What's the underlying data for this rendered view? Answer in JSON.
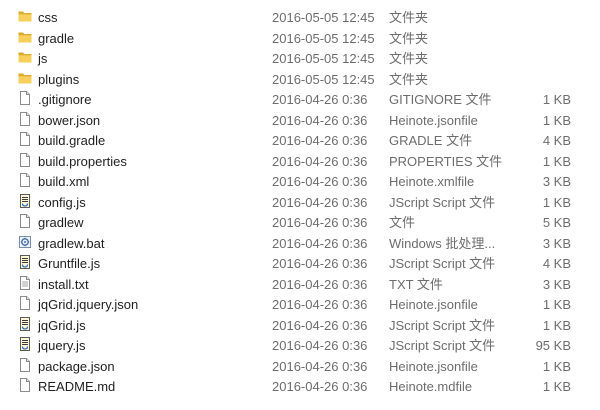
{
  "files": [
    {
      "name": "css",
      "date": "2016-05-05 12:45",
      "type": "文件夹",
      "size": "",
      "icon": "folder-icon"
    },
    {
      "name": "gradle",
      "date": "2016-05-05 12:45",
      "type": "文件夹",
      "size": "",
      "icon": "folder-icon"
    },
    {
      "name": "js",
      "date": "2016-05-05 12:45",
      "type": "文件夹",
      "size": "",
      "icon": "folder-icon"
    },
    {
      "name": "plugins",
      "date": "2016-05-05 12:45",
      "type": "文件夹",
      "size": "",
      "icon": "folder-icon"
    },
    {
      "name": ".gitignore",
      "date": "2016-04-26 0:36",
      "type": "GITIGNORE 文件",
      "size": "1 KB",
      "icon": "file-icon"
    },
    {
      "name": "bower.json",
      "date": "2016-04-26 0:36",
      "type": "Heinote.jsonfile",
      "size": "1 KB",
      "icon": "file-icon"
    },
    {
      "name": "build.gradle",
      "date": "2016-04-26 0:36",
      "type": "GRADLE 文件",
      "size": "4 KB",
      "icon": "file-icon"
    },
    {
      "name": "build.properties",
      "date": "2016-04-26 0:36",
      "type": "PROPERTIES 文件",
      "size": "1 KB",
      "icon": "file-icon"
    },
    {
      "name": "build.xml",
      "date": "2016-04-26 0:36",
      "type": "Heinote.xmlfile",
      "size": "3 KB",
      "icon": "file-icon"
    },
    {
      "name": "config.js",
      "date": "2016-04-26 0:36",
      "type": "JScript Script 文件",
      "size": "1 KB",
      "icon": "script-file-icon"
    },
    {
      "name": "gradlew",
      "date": "2016-04-26 0:36",
      "type": "文件",
      "size": "5 KB",
      "icon": "file-icon"
    },
    {
      "name": "gradlew.bat",
      "date": "2016-04-26 0:36",
      "type": "Windows 批处理...",
      "size": "3 KB",
      "icon": "batch-file-icon"
    },
    {
      "name": "Gruntfile.js",
      "date": "2016-04-26 0:36",
      "type": "JScript Script 文件",
      "size": "4 KB",
      "icon": "script-file-icon"
    },
    {
      "name": "install.txt",
      "date": "2016-04-26 0:36",
      "type": "TXT 文件",
      "size": "3 KB",
      "icon": "text-file-icon"
    },
    {
      "name": "jqGrid.jquery.json",
      "date": "2016-04-26 0:36",
      "type": "Heinote.jsonfile",
      "size": "1 KB",
      "icon": "file-icon"
    },
    {
      "name": "jqGrid.js",
      "date": "2016-04-26 0:36",
      "type": "JScript Script 文件",
      "size": "1 KB",
      "icon": "script-file-icon"
    },
    {
      "name": "jquery.js",
      "date": "2016-04-26 0:36",
      "type": "JScript Script 文件",
      "size": "95 KB",
      "icon": "script-file-icon"
    },
    {
      "name": "package.json",
      "date": "2016-04-26 0:36",
      "type": "Heinote.jsonfile",
      "size": "1 KB",
      "icon": "file-icon"
    },
    {
      "name": "README.md",
      "date": "2016-04-26 0:36",
      "type": "Heinote.mdfile",
      "size": "1 KB",
      "icon": "file-icon"
    }
  ]
}
